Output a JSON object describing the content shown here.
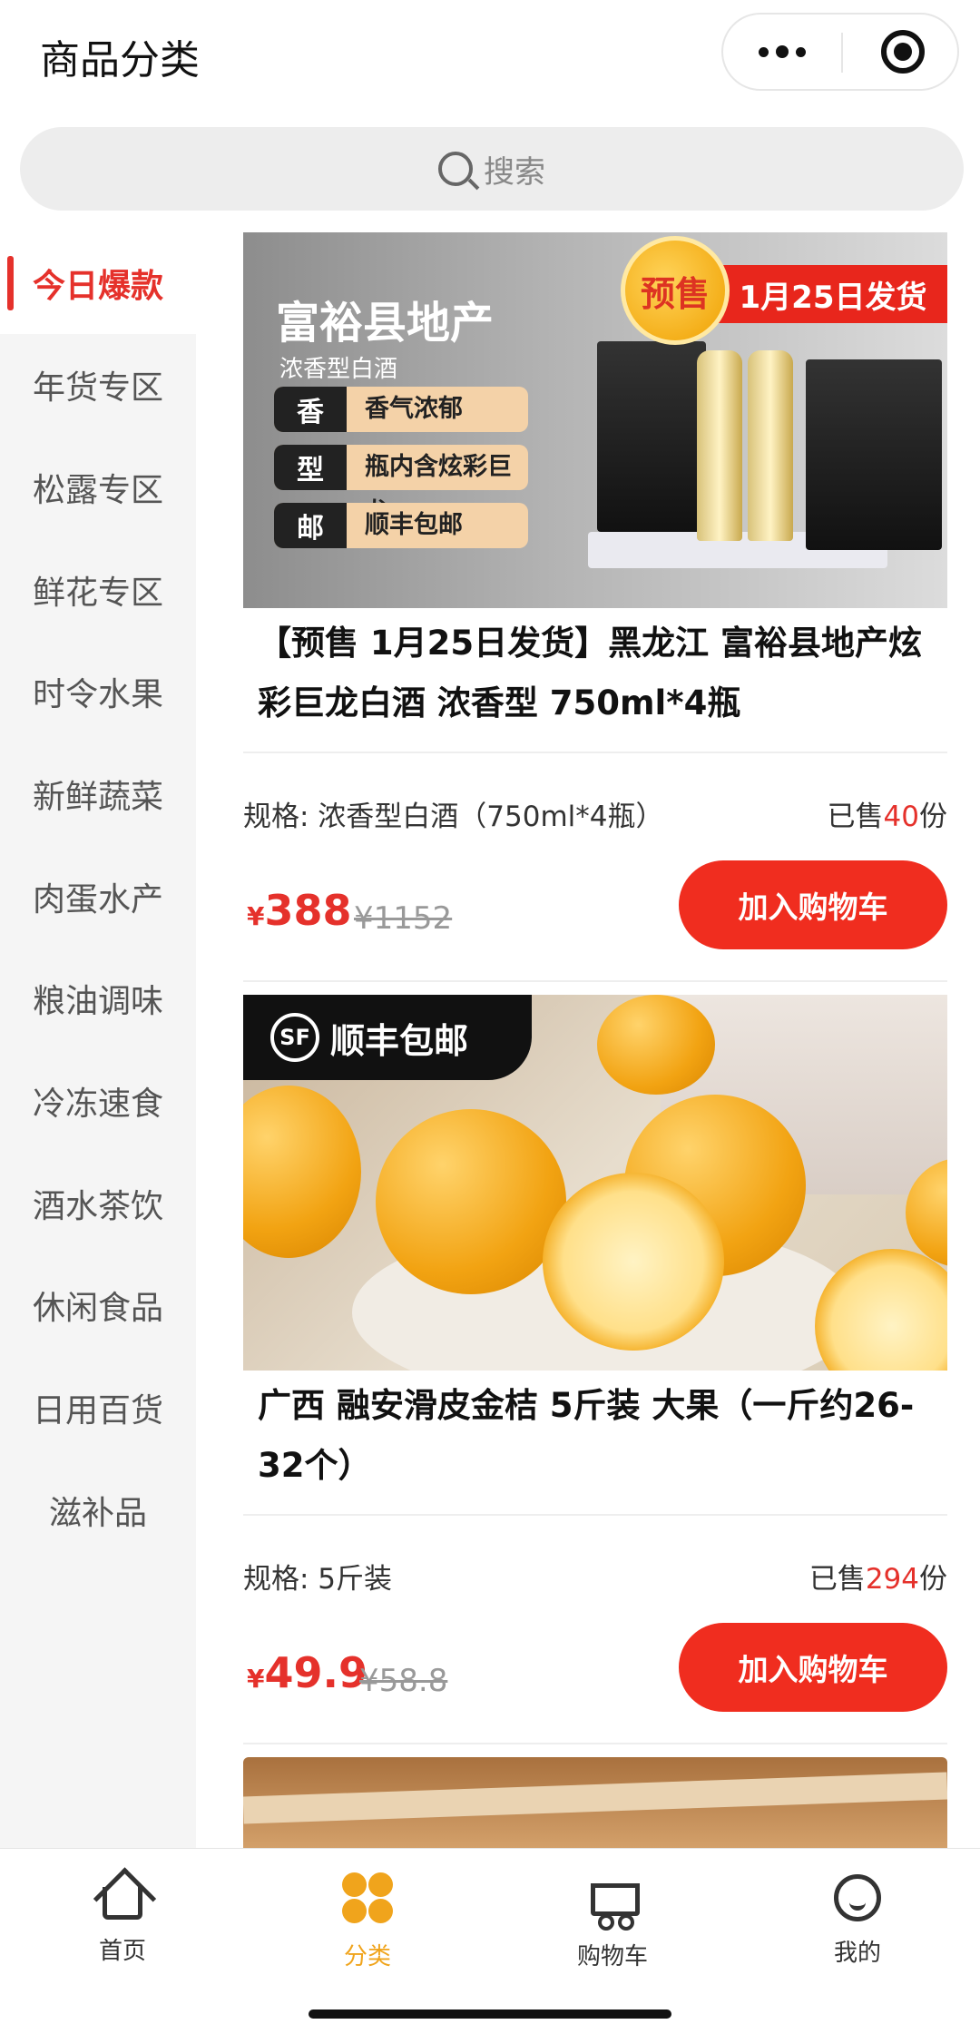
{
  "header": {
    "title": "商品分类"
  },
  "search": {
    "placeholder": "搜索"
  },
  "sidebar": {
    "items": [
      {
        "label": "今日爆款"
      },
      {
        "label": "年货专区"
      },
      {
        "label": "松露专区"
      },
      {
        "label": "鲜花专区"
      },
      {
        "label": "时令水果"
      },
      {
        "label": "新鲜蔬菜"
      },
      {
        "label": "肉蛋水产"
      },
      {
        "label": "粮油调味"
      },
      {
        "label": "冷冻速食"
      },
      {
        "label": "酒水茶饮"
      },
      {
        "label": "休闲食品"
      },
      {
        "label": "日用百货"
      },
      {
        "label": "滋补品"
      }
    ]
  },
  "products": [
    {
      "image": {
        "brand": "富裕县地产",
        "sub": "浓香型白酒",
        "rows": [
          {
            "k": "香",
            "v": "香气浓郁"
          },
          {
            "k": "型",
            "v": "瓶内含炫彩巨龙"
          },
          {
            "k": "邮",
            "v": "顺丰包邮"
          }
        ],
        "badge": "预售",
        "ship_date": "1月25日发货"
      },
      "title": "【预售 1月25日发货】黑龙江 富裕县地产炫彩巨龙白酒 浓香型 750ml*4瓶",
      "spec": "规格: 浓香型白酒（750ml*4瓶）",
      "sold_prefix": "已售",
      "sold_count": "40",
      "sold_suffix": "份",
      "currency": "¥",
      "price": "388",
      "original_price": "¥1152",
      "cart_label": "加入购物车"
    },
    {
      "image": {
        "sf_logo": "SF",
        "sf_label": "顺丰包邮"
      },
      "title": "广西 融安滑皮金桔 5斤装 大果（一斤约26-32个）",
      "spec": "规格: 5斤装",
      "sold_prefix": "已售",
      "sold_count": "294",
      "sold_suffix": "份",
      "currency": "¥",
      "price": "49.9",
      "original_price": "¥58.8",
      "cart_label": "加入购物车"
    }
  ],
  "tabbar": {
    "items": [
      {
        "label": "首页",
        "icon": "home-icon"
      },
      {
        "label": "分类",
        "icon": "category-icon"
      },
      {
        "label": "购物车",
        "icon": "cart-icon"
      },
      {
        "label": "我的",
        "icon": "profile-icon"
      }
    ],
    "active_color": "#f0a41c"
  },
  "colors": {
    "accent": "#e5312b",
    "button": "#f02d1f"
  }
}
